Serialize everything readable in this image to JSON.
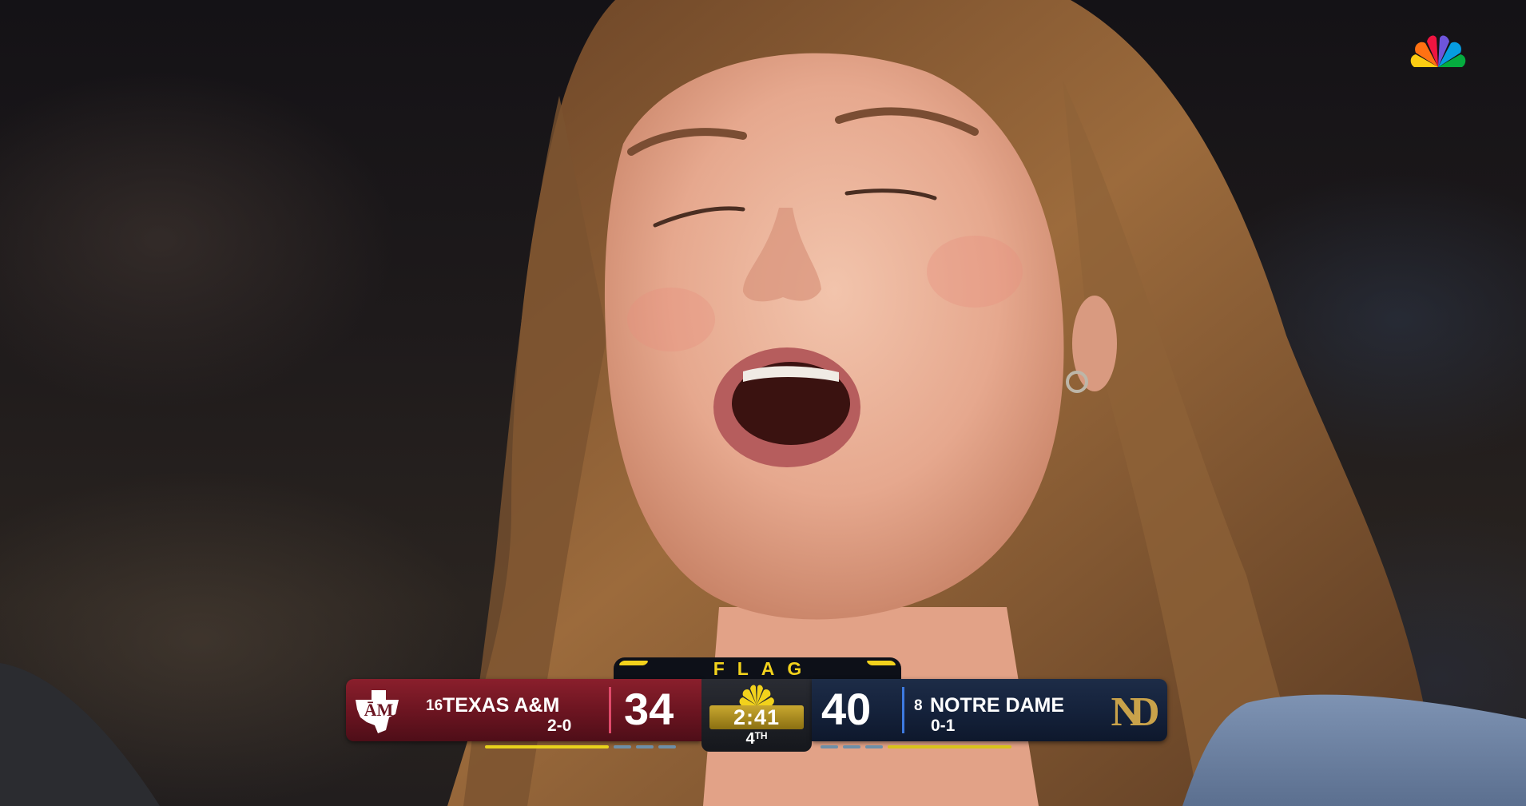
{
  "broadcast": {
    "network_logo": "nbc-peacock-icon",
    "network_colors": [
      "#fccc12",
      "#ff7112",
      "#ef1541",
      "#6e55dc",
      "#069de0",
      "#05ac3f"
    ]
  },
  "scorebug": {
    "status_tab": "FLAG",
    "status_color": "#f2d21c",
    "clock": "2:41",
    "quarter": "4",
    "quarter_suffix": "TH",
    "away": {
      "rank": "16",
      "name": "TEXAS A&M",
      "record": "2-0",
      "score": "34",
      "logo": "texas-am-logo-icon",
      "color": "#6a1420"
    },
    "home": {
      "rank": "8",
      "name": "NOTRE DAME",
      "record": "0-1",
      "score": "40",
      "logo": "notre-dame-logo-icon",
      "color": "#14213a"
    }
  }
}
